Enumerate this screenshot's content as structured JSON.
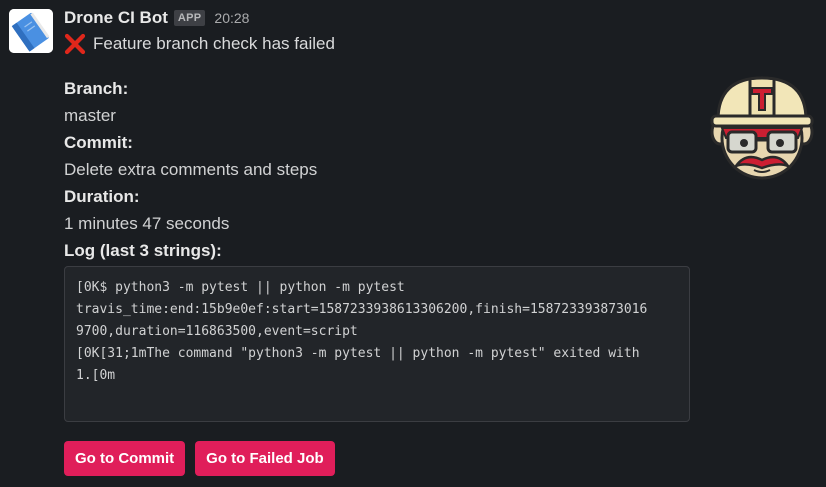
{
  "message": {
    "bot_name": "Drone CI Bot",
    "badge": "APP",
    "timestamp": "20:28",
    "status_icon": "cross-mark-icon",
    "status_text": "Feature branch check has failed"
  },
  "fields": {
    "branch_label": "Branch:",
    "branch_value": "master",
    "commit_label": "Commit:",
    "commit_value": "Delete extra comments and steps",
    "duration_label": "Duration:",
    "duration_value": "1 minutes 47 seconds",
    "log_label": "Log (last 3 strings):"
  },
  "log": {
    "lines": [
      "[0K$ python3 -m pytest || python -m pytest",
      "travis_time:end:15b9e0ef:start=1587233938613306200,finish=158723393873016",
      "9700,duration=116863500,event=script",
      "[0K[31;1mThe command \"python3 -m pytest || python -m pytest\" exited with",
      "1.[0m"
    ]
  },
  "buttons": {
    "commit": "Go to Commit",
    "failed_job": "Go to Failed Job"
  },
  "colors": {
    "background": "#1a1d21",
    "button": "#e01e5a",
    "code_bg": "#222529"
  },
  "icons": {
    "avatar": "notebook-icon",
    "mascot": "travis-mascot-icon"
  }
}
